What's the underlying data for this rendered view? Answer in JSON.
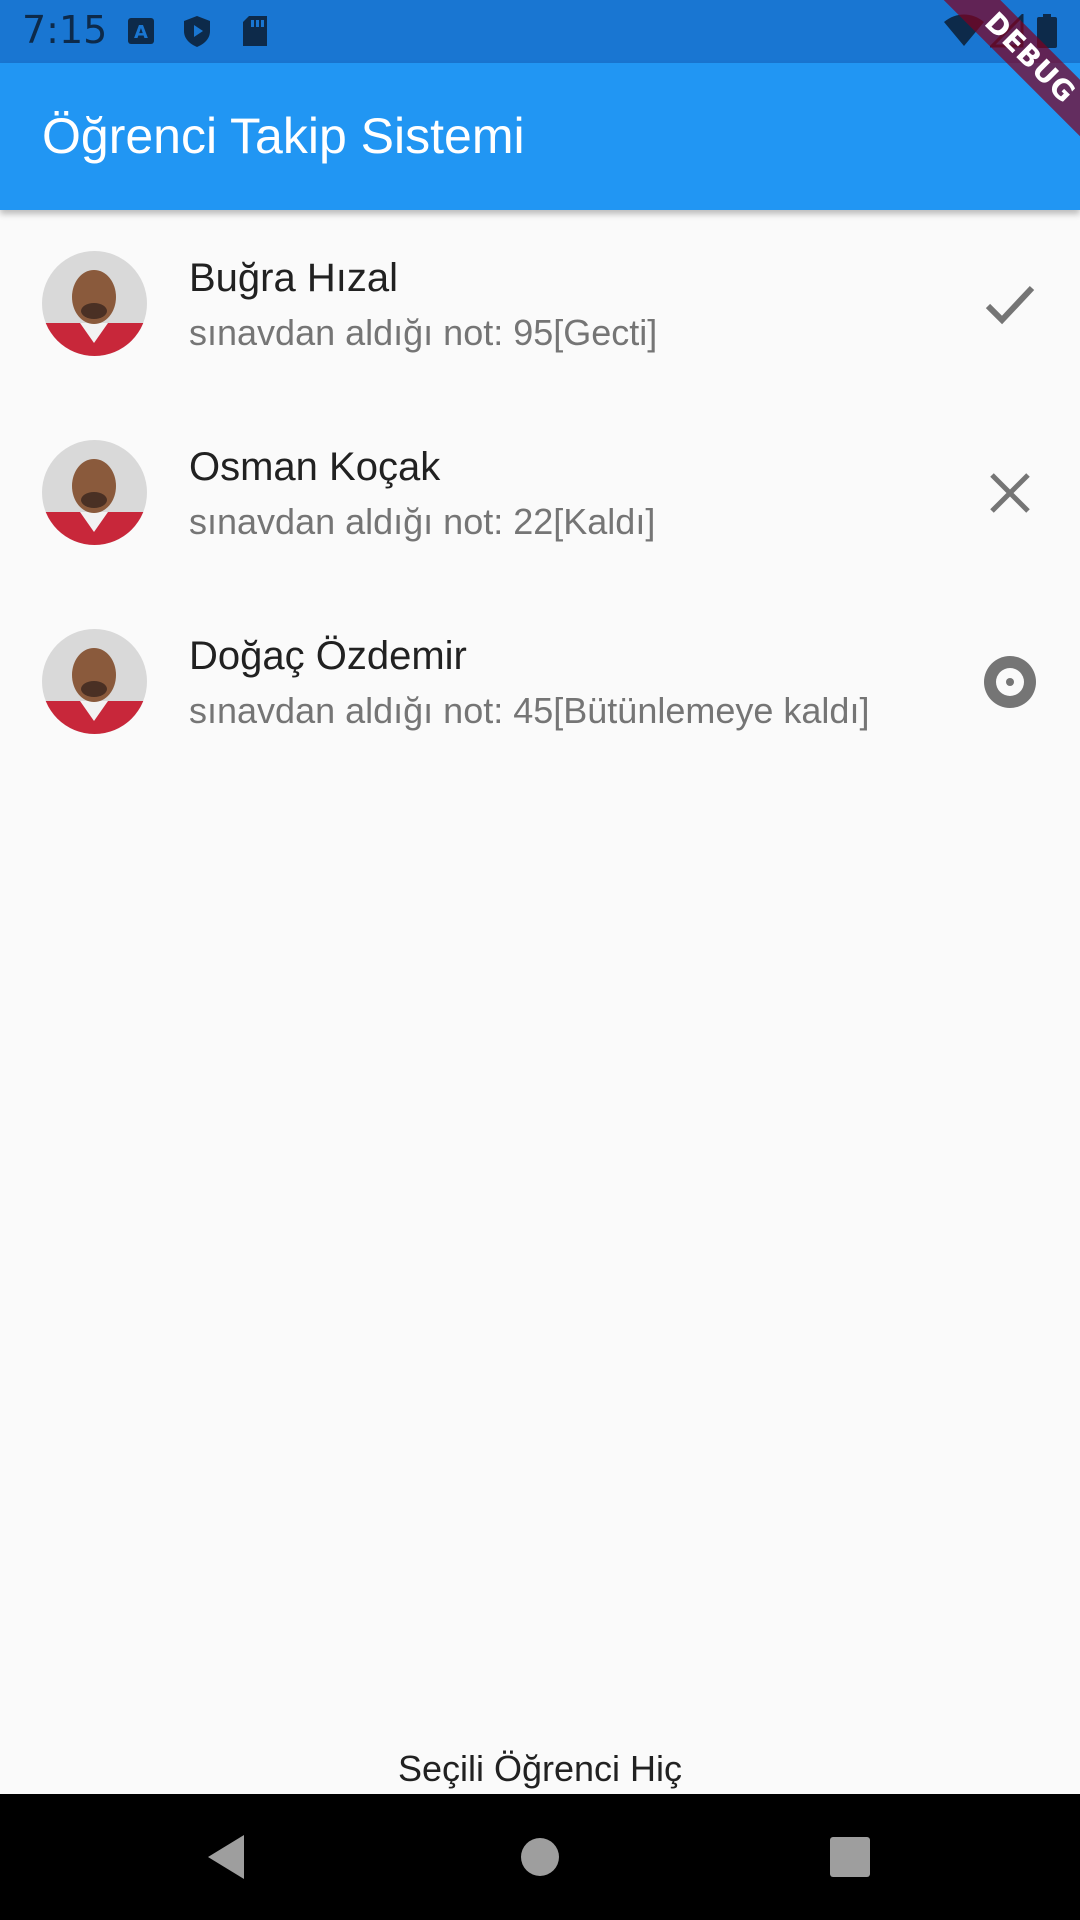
{
  "status_bar": {
    "time": "7:15",
    "icons_left": [
      "a-notification-icon",
      "shield-play-icon",
      "sd-card-icon"
    ],
    "icons_right": [
      "wifi-icon",
      "signal-icon",
      "battery-icon"
    ],
    "background": "#1976d2"
  },
  "app_bar": {
    "title": "Öğrenci Takip Sistemi",
    "background": "#2196f3"
  },
  "debug_banner": "DEBUG",
  "students": [
    {
      "name": "Buğra Hızal",
      "subtitle": "sınavdan aldığı not: 95[Gecti]",
      "status_icon": "check-icon"
    },
    {
      "name": "Osman Koçak",
      "subtitle": "sınavdan aldığı not: 22[Kaldı]",
      "status_icon": "close-icon"
    },
    {
      "name": "Doğaç Özdemir",
      "subtitle": "sınavdan aldığı not: 45[Bütünlemeye kaldı]",
      "status_icon": "radio-target-icon"
    }
  ],
  "selected_label": "Seçili Öğrenci Hiç",
  "nav_bar": {
    "buttons": [
      "back-icon",
      "home-icon",
      "recents-icon"
    ]
  }
}
